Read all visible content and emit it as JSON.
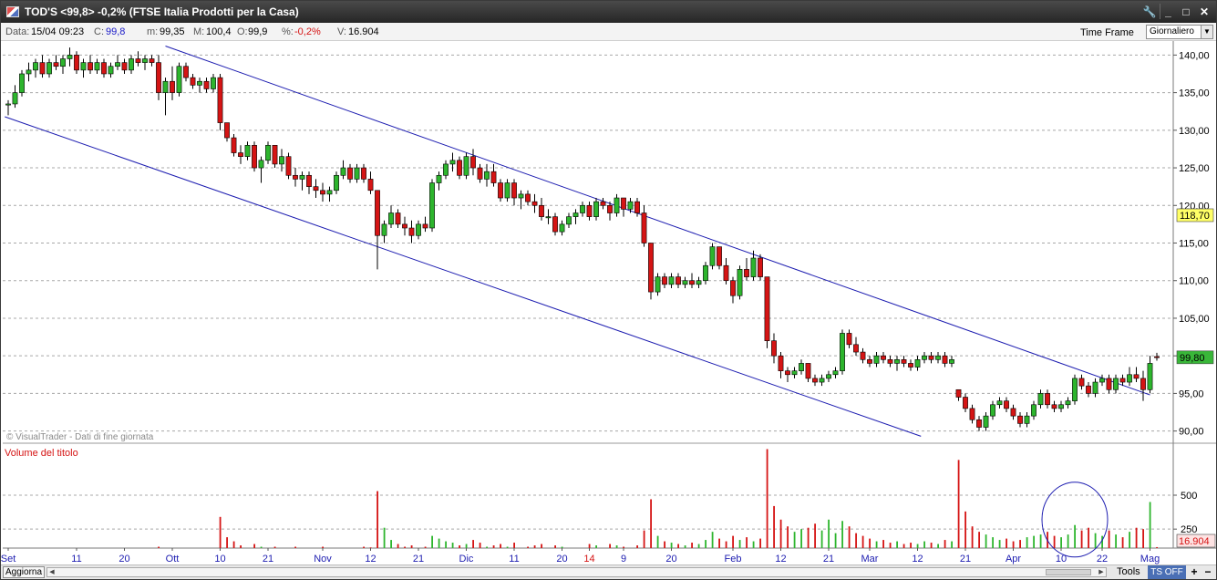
{
  "window": {
    "title": "TOD'S <99,8> -0,2%  (FTSE Italia Prodotti per la Casa)",
    "controls": [
      "🔧",
      "_",
      "□",
      "✕"
    ]
  },
  "infobar": {
    "data_label": "Data:",
    "data_value": "15/04 09:23",
    "close_label": "C:",
    "close_value": "99,8",
    "min_label": "m:",
    "min_value": "99,35",
    "max_label": "M:",
    "max_value": "100,4",
    "open_label": "O:",
    "open_value": "99,9",
    "pct_label": "%:",
    "pct_value": "-0,2%",
    "vol_label": "V:",
    "vol_value": "16.904",
    "timeframe_label": "Time Frame",
    "timeframe_value": "Giornaliero"
  },
  "bottombar": {
    "refresh_label": "Aggiorna",
    "tools_label": "Tools",
    "ts_label": "TS OFF",
    "zoom_in": "+",
    "zoom_out": "−"
  },
  "colors": {
    "up": "#2db52d",
    "down": "#d51414",
    "trend": "#1c1cb0",
    "grid": "#a8a8a8",
    "flag_yellow": "#ffff66",
    "flag_green": "#39b739",
    "volume_flag": "#fde3e3"
  },
  "chart_data": {
    "type": "candlestick",
    "watermark": "© VisualTrader - Dati di fine giornata",
    "price_axis": {
      "ylim": [
        88.5,
        141.5
      ],
      "ticks": [
        140,
        135,
        130,
        125,
        120,
        115,
        110,
        105,
        100,
        95,
        90
      ],
      "tick_labels": [
        "140,00",
        "135,00",
        "130,00",
        "125,00",
        "120,00",
        "115,00",
        "110,00",
        "105,00",
        "100,00",
        "95,00",
        "90,00"
      ],
      "flags": [
        {
          "label": "118,70",
          "value": 118.7,
          "color": "#ffff66"
        },
        {
          "label": "99,80",
          "value": 99.8,
          "color": "#39b739"
        }
      ]
    },
    "volume_panel": {
      "title": "Volume del titolo",
      "ylim": [
        110,
        870
      ],
      "ticks": [
        500,
        250
      ],
      "tick_labels": [
        "500",
        "250"
      ],
      "flag": {
        "label": "16.904",
        "value": 16.904
      }
    },
    "x_axis_labels": [
      {
        "i": 0,
        "label": "Set",
        "red": false
      },
      {
        "i": 10,
        "label": "11",
        "red": false
      },
      {
        "i": 17,
        "label": "20",
        "red": false
      },
      {
        "i": 24,
        "label": "Ott",
        "red": false
      },
      {
        "i": 31,
        "label": "10",
        "red": false
      },
      {
        "i": 38,
        "label": "21",
        "red": false
      },
      {
        "i": 46,
        "label": "Nov",
        "red": false
      },
      {
        "i": 53,
        "label": "12",
        "red": false
      },
      {
        "i": 60,
        "label": "21",
        "red": false
      },
      {
        "i": 67,
        "label": "Dic",
        "red": false
      },
      {
        "i": 74,
        "label": "11",
        "red": false
      },
      {
        "i": 81,
        "label": "20",
        "red": false
      },
      {
        "i": 85,
        "label": "14",
        "red": true
      },
      {
        "i": 90,
        "label": "9",
        "red": false
      },
      {
        "i": 97,
        "label": "20",
        "red": false
      },
      {
        "i": 106,
        "label": "Feb",
        "red": false
      },
      {
        "i": 113,
        "label": "12",
        "red": false
      },
      {
        "i": 120,
        "label": "21",
        "red": false
      },
      {
        "i": 126,
        "label": "Mar",
        "red": false
      },
      {
        "i": 133,
        "label": "12",
        "red": false
      },
      {
        "i": 140,
        "label": "21",
        "red": false
      },
      {
        "i": 147,
        "label": "Apr",
        "red": false
      },
      {
        "i": 154,
        "label": "10",
        "red": false
      },
      {
        "i": 160,
        "label": "22",
        "red": false
      },
      {
        "i": 167,
        "label": "Mag",
        "red": false
      }
    ],
    "trendlines": [
      {
        "x1": -0.5,
        "y1": 131.8,
        "x2": 133.5,
        "y2": 89.3
      },
      {
        "x1": 23,
        "y1": 141.2,
        "x2": 167,
        "y2": 94.8
      }
    ],
    "highlight_circle": {
      "i": 156,
      "volume": 320
    },
    "candles": [
      [
        133.5,
        134.0,
        132.0,
        133.5,
        60
      ],
      [
        133.5,
        136.0,
        133.0,
        135.0,
        75
      ],
      [
        135.0,
        138.0,
        134.5,
        137.5,
        65
      ],
      [
        137.5,
        139.0,
        136.5,
        138.0,
        55
      ],
      [
        138.0,
        139.5,
        137.0,
        139.0,
        60
      ],
      [
        139.0,
        140.0,
        137.0,
        137.5,
        80
      ],
      [
        137.5,
        139.5,
        137.0,
        139.0,
        50
      ],
      [
        139.0,
        140.0,
        138.0,
        138.5,
        70
      ],
      [
        138.5,
        140.0,
        137.5,
        139.5,
        55
      ],
      [
        139.5,
        141.0,
        138.5,
        140.0,
        80
      ],
      [
        140.0,
        140.5,
        137.5,
        138.0,
        95
      ],
      [
        138.0,
        139.5,
        137.0,
        139.0,
        60
      ],
      [
        139.0,
        140.0,
        137.5,
        138.0,
        50
      ],
      [
        138.0,
        139.5,
        137.5,
        139.0,
        65
      ],
      [
        139.0,
        139.5,
        137.0,
        137.5,
        55
      ],
      [
        137.5,
        139.0,
        137.0,
        138.5,
        70
      ],
      [
        138.5,
        140.0,
        138.0,
        139.0,
        55
      ],
      [
        139.0,
        139.5,
        137.5,
        138.0,
        60
      ],
      [
        138.0,
        140.0,
        137.5,
        139.5,
        70
      ],
      [
        139.5,
        140.5,
        138.5,
        139.0,
        55
      ],
      [
        139.0,
        140.0,
        138.0,
        139.5,
        65
      ],
      [
        139.5,
        140.0,
        138.5,
        139.0,
        50
      ],
      [
        139.0,
        140.0,
        134.0,
        135.0,
        120
      ],
      [
        135.0,
        137.0,
        132.0,
        136.5,
        90
      ],
      [
        136.5,
        138.5,
        134.0,
        135.0,
        75
      ],
      [
        135.0,
        139.0,
        134.5,
        138.5,
        60
      ],
      [
        138.5,
        139.0,
        136.5,
        137.0,
        55
      ],
      [
        137.0,
        137.5,
        135.5,
        136.0,
        65
      ],
      [
        136.0,
        137.0,
        135.0,
        136.5,
        55
      ],
      [
        136.5,
        137.0,
        135.0,
        135.5,
        60
      ],
      [
        135.5,
        137.5,
        135.0,
        137.0,
        70
      ],
      [
        137.0,
        137.5,
        130.0,
        131.0,
        340
      ],
      [
        131.0,
        131.0,
        128.5,
        129.0,
        190
      ],
      [
        129.0,
        129.5,
        126.5,
        127.0,
        160
      ],
      [
        127.0,
        128.0,
        125.5,
        126.5,
        130
      ],
      [
        126.5,
        128.5,
        126.0,
        128.0,
        110
      ],
      [
        128.0,
        128.5,
        124.5,
        125.0,
        140
      ],
      [
        125.0,
        126.5,
        123.0,
        126.0,
        120
      ],
      [
        126.0,
        128.5,
        125.5,
        128.0,
        100
      ],
      [
        128.0,
        128.0,
        125.0,
        125.5,
        120
      ],
      [
        125.5,
        127.5,
        124.5,
        126.5,
        95
      ],
      [
        126.5,
        127.0,
        123.5,
        124.0,
        110
      ],
      [
        124.0,
        125.0,
        122.5,
        123.5,
        120
      ],
      [
        123.5,
        124.5,
        122.0,
        124.0,
        95
      ],
      [
        124.0,
        124.5,
        121.5,
        122.5,
        100
      ],
      [
        122.5,
        123.5,
        121.0,
        122.0,
        110
      ],
      [
        122.0,
        123.0,
        120.5,
        121.5,
        120
      ],
      [
        121.5,
        122.5,
        120.5,
        122.0,
        90
      ],
      [
        122.0,
        124.5,
        121.5,
        124.0,
        100
      ],
      [
        124.0,
        126.0,
        123.5,
        125.0,
        110
      ],
      [
        125.0,
        125.5,
        123.0,
        123.5,
        95
      ],
      [
        123.5,
        125.5,
        123.0,
        125.0,
        90
      ],
      [
        125.0,
        125.5,
        123.0,
        123.5,
        120
      ],
      [
        123.5,
        124.5,
        121.5,
        122.0,
        115
      ],
      [
        122.0,
        116.0,
        111.5,
        116.0,
        530
      ],
      [
        116.0,
        118.0,
        115.0,
        117.5,
        260
      ],
      [
        117.5,
        120.0,
        117.0,
        119.0,
        170
      ],
      [
        119.0,
        119.5,
        117.0,
        117.5,
        140
      ],
      [
        117.5,
        118.5,
        116.0,
        117.0,
        120
      ],
      [
        117.0,
        118.0,
        115.0,
        116.0,
        130
      ],
      [
        116.0,
        118.0,
        115.5,
        117.5,
        110
      ],
      [
        117.5,
        118.5,
        116.5,
        117.0,
        120
      ],
      [
        117.0,
        123.5,
        116.5,
        123.0,
        200
      ],
      [
        123.0,
        124.5,
        122.0,
        124.0,
        180
      ],
      [
        124.0,
        126.0,
        123.5,
        125.5,
        160
      ],
      [
        125.5,
        127.0,
        124.5,
        126.0,
        150
      ],
      [
        126.0,
        126.5,
        123.5,
        124.0,
        130
      ],
      [
        124.0,
        127.0,
        123.5,
        126.5,
        140
      ],
      [
        126.5,
        127.5,
        124.0,
        125.0,
        170
      ],
      [
        125.0,
        125.5,
        123.0,
        123.5,
        150
      ],
      [
        123.5,
        125.5,
        122.5,
        124.5,
        120
      ],
      [
        124.5,
        125.5,
        122.5,
        123.0,
        130
      ],
      [
        123.0,
        123.5,
        120.5,
        121.0,
        140
      ],
      [
        121.0,
        123.5,
        120.5,
        123.0,
        120
      ],
      [
        123.0,
        123.5,
        120.0,
        121.0,
        150
      ],
      [
        121.0,
        122.0,
        119.5,
        121.5,
        110
      ],
      [
        121.5,
        122.0,
        120.0,
        120.5,
        120
      ],
      [
        120.5,
        121.5,
        119.0,
        120.0,
        130
      ],
      [
        120.0,
        121.0,
        118.0,
        118.5,
        140
      ],
      [
        118.5,
        119.5,
        117.5,
        118.5,
        110
      ],
      [
        118.5,
        119.0,
        116.0,
        116.5,
        130
      ],
      [
        116.5,
        118.0,
        116.0,
        117.5,
        120
      ],
      [
        117.5,
        119.0,
        117.0,
        118.5,
        110
      ],
      [
        118.5,
        119.5,
        117.5,
        119.0,
        100
      ],
      [
        119.0,
        120.5,
        118.5,
        120.0,
        110
      ],
      [
        120.0,
        120.5,
        118.0,
        118.5,
        140
      ],
      [
        118.5,
        121.0,
        118.0,
        120.5,
        130
      ],
      [
        120.5,
        121.0,
        119.5,
        120.0,
        110
      ],
      [
        120.0,
        120.5,
        118.0,
        119.0,
        140
      ],
      [
        119.0,
        121.5,
        118.5,
        121.0,
        130
      ],
      [
        121.0,
        121.0,
        118.5,
        119.5,
        120
      ],
      [
        119.5,
        121.0,
        119.0,
        120.5,
        110
      ],
      [
        120.5,
        121.0,
        118.5,
        119.0,
        130
      ],
      [
        119.0,
        120.0,
        114.5,
        115.0,
        240
      ],
      [
        115.0,
        113.0,
        107.5,
        108.5,
        470
      ],
      [
        108.5,
        111.0,
        108.0,
        110.5,
        200
      ],
      [
        110.5,
        111.0,
        109.0,
        109.5,
        160
      ],
      [
        109.5,
        111.0,
        109.0,
        110.5,
        150
      ],
      [
        110.5,
        111.0,
        109.0,
        109.5,
        140
      ],
      [
        109.5,
        110.5,
        109.0,
        110.0,
        130
      ],
      [
        110.0,
        111.0,
        109.0,
        109.5,
        150
      ],
      [
        109.5,
        110.5,
        109.0,
        110.0,
        140
      ],
      [
        110.0,
        112.5,
        109.5,
        112.0,
        170
      ],
      [
        112.0,
        115.0,
        111.5,
        114.5,
        230
      ],
      [
        114.5,
        114.5,
        111.5,
        112.0,
        180
      ],
      [
        112.0,
        113.0,
        109.5,
        110.0,
        160
      ],
      [
        110.0,
        110.5,
        107.0,
        108.0,
        200
      ],
      [
        108.0,
        112.0,
        107.5,
        111.5,
        170
      ],
      [
        111.5,
        113.0,
        110.0,
        110.5,
        190
      ],
      [
        110.5,
        114.0,
        110.0,
        113.0,
        160
      ],
      [
        113.0,
        113.5,
        110.0,
        110.5,
        180
      ],
      [
        110.5,
        106.5,
        101.0,
        102.0,
        840
      ],
      [
        102.0,
        103.0,
        99.0,
        100.0,
        420
      ],
      [
        100.0,
        100.5,
        97.0,
        98.0,
        320
      ],
      [
        98.0,
        98.5,
        96.5,
        97.5,
        270
      ],
      [
        97.5,
        98.5,
        97.0,
        98.0,
        230
      ],
      [
        98.0,
        99.5,
        97.5,
        99.0,
        250
      ],
      [
        99.0,
        99.0,
        96.5,
        97.0,
        260
      ],
      [
        97.0,
        97.5,
        96.0,
        96.5,
        290
      ],
      [
        96.5,
        97.5,
        96.0,
        97.0,
        240
      ],
      [
        97.0,
        98.0,
        96.5,
        97.5,
        320
      ],
      [
        97.5,
        98.5,
        97.0,
        98.0,
        220
      ],
      [
        98.0,
        103.5,
        97.5,
        103.0,
        310
      ],
      [
        103.0,
        103.5,
        101.0,
        101.5,
        270
      ],
      [
        101.5,
        102.5,
        100.0,
        100.5,
        220
      ],
      [
        100.5,
        101.0,
        99.0,
        99.5,
        200
      ],
      [
        99.5,
        100.0,
        98.5,
        99.0,
        180
      ],
      [
        99.0,
        100.5,
        98.5,
        100.0,
        160
      ],
      [
        100.0,
        100.5,
        99.0,
        99.5,
        170
      ],
      [
        99.5,
        100.0,
        98.5,
        99.0,
        150
      ],
      [
        99.0,
        100.0,
        98.0,
        99.5,
        160
      ],
      [
        99.5,
        100.0,
        98.5,
        99.0,
        140
      ],
      [
        99.0,
        99.5,
        98.0,
        98.5,
        150
      ],
      [
        98.5,
        100.0,
        98.0,
        99.5,
        140
      ],
      [
        99.5,
        100.5,
        99.0,
        100.0,
        160
      ],
      [
        100.0,
        100.5,
        99.0,
        99.5,
        150
      ],
      [
        99.5,
        100.5,
        99.0,
        100.0,
        140
      ],
      [
        100.0,
        100.5,
        98.5,
        99.0,
        170
      ],
      [
        99.0,
        100.0,
        98.5,
        99.5,
        160
      ],
      [
        95.5,
        95.5,
        94.0,
        94.5,
        760
      ],
      [
        94.5,
        95.0,
        92.5,
        93.0,
        380
      ],
      [
        93.0,
        93.5,
        91.0,
        91.5,
        270
      ],
      [
        91.5,
        92.0,
        90.0,
        90.5,
        230
      ],
      [
        90.5,
        92.5,
        90.0,
        92.0,
        210
      ],
      [
        92.0,
        94.0,
        91.5,
        93.5,
        190
      ],
      [
        93.5,
        94.5,
        93.0,
        94.0,
        170
      ],
      [
        94.0,
        94.5,
        92.5,
        93.0,
        180
      ],
      [
        93.0,
        93.5,
        91.5,
        92.0,
        160
      ],
      [
        92.0,
        92.5,
        90.5,
        91.0,
        170
      ],
      [
        91.0,
        92.5,
        90.5,
        92.0,
        190
      ],
      [
        92.0,
        94.0,
        91.5,
        93.5,
        200
      ],
      [
        93.5,
        95.5,
        93.0,
        95.0,
        210
      ],
      [
        95.0,
        95.5,
        93.0,
        93.5,
        230
      ],
      [
        93.5,
        94.0,
        92.5,
        93.0,
        200
      ],
      [
        93.0,
        94.0,
        92.5,
        93.5,
        190
      ],
      [
        93.5,
        94.5,
        93.0,
        94.0,
        210
      ],
      [
        94.0,
        97.5,
        93.5,
        97.0,
        280
      ],
      [
        97.0,
        97.5,
        95.5,
        96.0,
        240
      ],
      [
        96.0,
        96.5,
        94.5,
        95.0,
        260
      ],
      [
        95.0,
        97.0,
        94.5,
        96.5,
        220
      ],
      [
        96.5,
        97.5,
        96.0,
        97.0,
        200
      ],
      [
        97.0,
        97.5,
        95.0,
        95.5,
        240
      ],
      [
        95.5,
        97.5,
        95.0,
        97.0,
        210
      ],
      [
        97.0,
        97.5,
        96.0,
        96.5,
        190
      ],
      [
        96.5,
        98.5,
        96.0,
        97.5,
        230
      ],
      [
        97.5,
        98.5,
        96.5,
        97.0,
        260
      ],
      [
        97.0,
        98.0,
        94.0,
        95.5,
        250
      ],
      [
        95.5,
        100.0,
        95.0,
        99.0,
        450
      ],
      [
        99.9,
        100.4,
        99.35,
        99.8,
        117
      ]
    ]
  }
}
